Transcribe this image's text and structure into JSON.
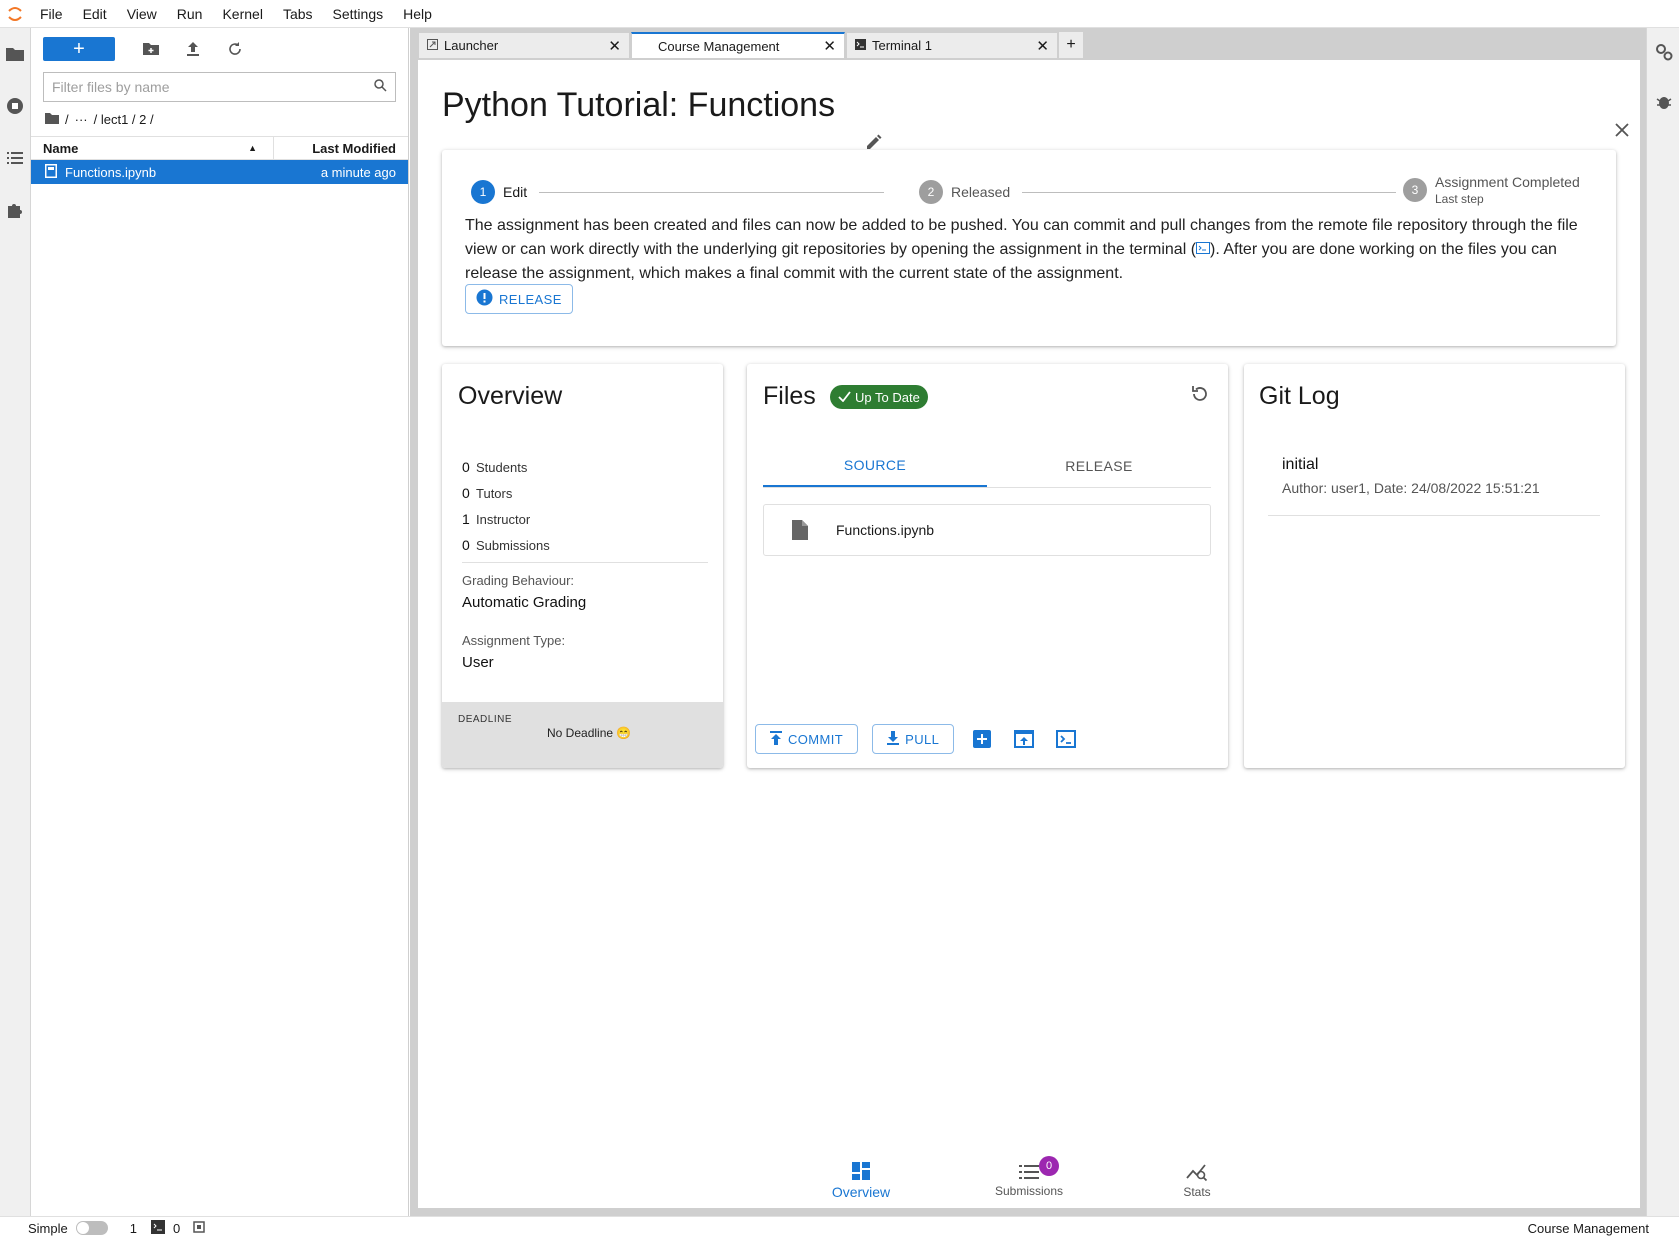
{
  "menubar": {
    "items": [
      "File",
      "Edit",
      "View",
      "Run",
      "Kernel",
      "Tabs",
      "Settings",
      "Help"
    ]
  },
  "filebrowser": {
    "new_label": "+",
    "filter_placeholder": "Filter files by name",
    "breadcrumb": [
      "/",
      "···",
      "/ lect1 / 2 /"
    ],
    "columns": {
      "name": "Name",
      "modified": "Last Modified"
    },
    "rows": [
      {
        "name": "Functions.ipynb",
        "modified": "a minute ago"
      }
    ]
  },
  "tabs": [
    {
      "label": "Launcher"
    },
    {
      "label": "Course Management"
    },
    {
      "label": "Terminal 1"
    }
  ],
  "assignment": {
    "title": "Python Tutorial: Functions",
    "steps": [
      {
        "num": "1",
        "label": "Edit",
        "sub": ""
      },
      {
        "num": "2",
        "label": "Released",
        "sub": ""
      },
      {
        "num": "3",
        "label": "Assignment Completed",
        "sub": "Last step"
      }
    ],
    "description_1": "The assignment has been created and files can now be added to be pushed. You can commit and pull changes from the remote file repository through the file view or can work directly with the underlying git repositories by opening the assignment in the terminal (",
    "description_2": "). After you are done working on the files you can release the assignment, which makes a final commit with the current state of the assignment.",
    "release_label": "RELEASE"
  },
  "overview": {
    "title": "Overview",
    "stats": [
      {
        "count": "0",
        "label": "Students"
      },
      {
        "count": "0",
        "label": "Tutors"
      },
      {
        "count": "1",
        "label": "Instructor"
      },
      {
        "count": "0",
        "label": "Submissions"
      }
    ],
    "grading_label": "Grading Behaviour:",
    "grading_value": "Automatic Grading",
    "type_label": "Assignment Type:",
    "type_value": "User",
    "deadline_label": "DEADLINE",
    "deadline_value": "No Deadline 😁"
  },
  "files": {
    "title": "Files",
    "status": "Up To Date",
    "tabs": [
      "SOURCE",
      "RELEASE"
    ],
    "items": [
      "Functions.ipynb"
    ],
    "commit_label": "COMMIT",
    "pull_label": "PULL"
  },
  "gitlog": {
    "title": "Git Log",
    "entries": [
      {
        "message": "initial",
        "meta": "Author: user1, Date: 24/08/2022 15:51:21"
      }
    ]
  },
  "bottom_nav": {
    "items": [
      "Overview",
      "Submissions",
      "Stats"
    ],
    "submissions_badge": "0"
  },
  "statusbar": {
    "mode": "Simple",
    "kernels": "1",
    "terminals": "0",
    "right": "Course Management"
  },
  "colors": {
    "accent": "#1976d2",
    "success": "#2e7d32",
    "badge": "#9c27b0"
  }
}
